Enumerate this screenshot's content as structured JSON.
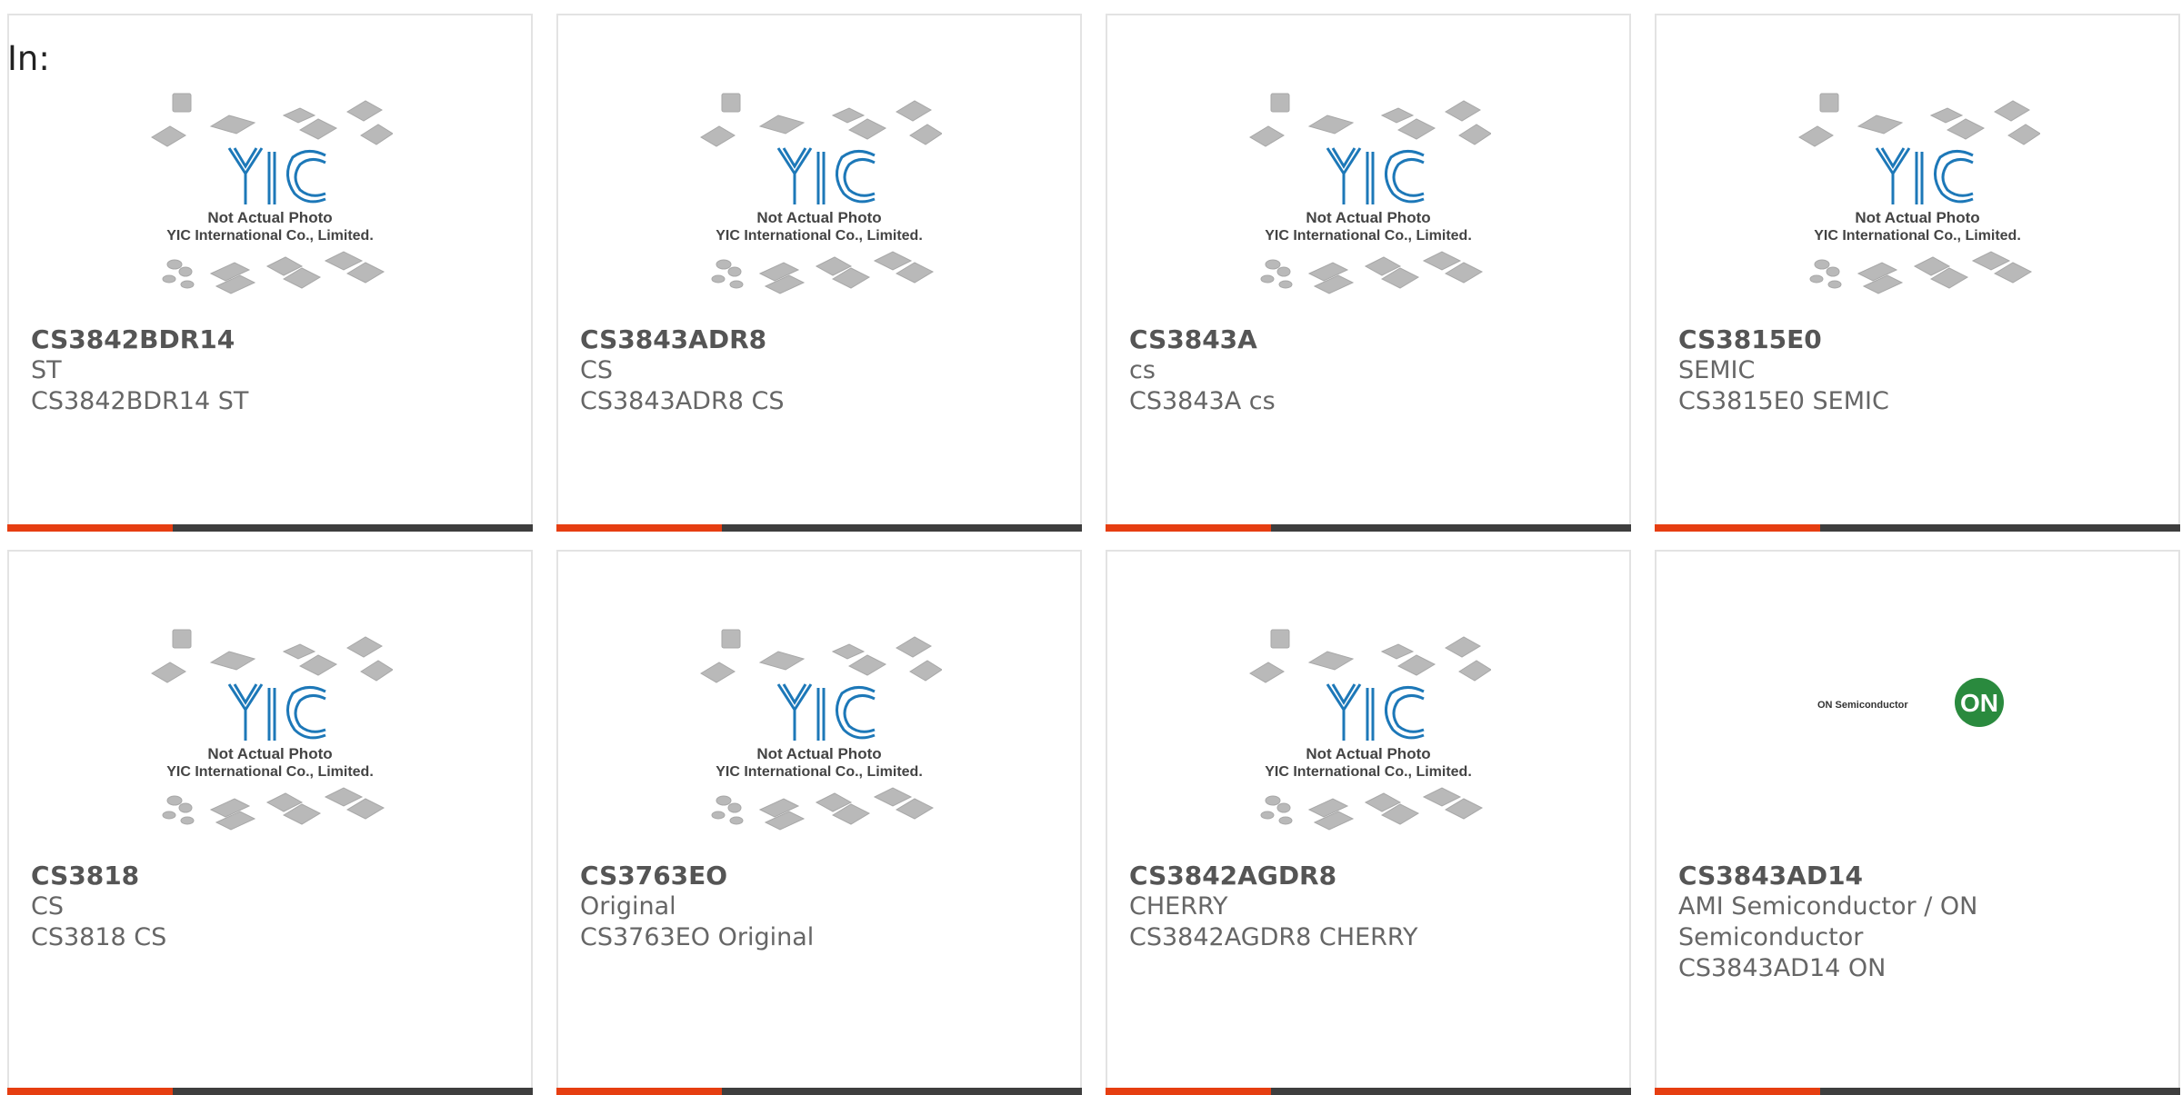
{
  "header": {
    "label": "In:"
  },
  "placeholder": {
    "line1": "Not Actual Photo",
    "line2": "YIC International Co., Limited.",
    "brand": "YIC"
  },
  "brand_logo": {
    "text": "ON Semiconductor",
    "badge": "ON",
    "badge_color": "#2a8a3e"
  },
  "colors": {
    "accent": "#e63e11",
    "bar": "#3e3e3e",
    "border": "#e3e3e3"
  },
  "products": [
    {
      "part": "CS3842BDR14",
      "mfr": "ST",
      "desc": "CS3842BDR14 ST"
    },
    {
      "part": "CS3843ADR8",
      "mfr": "CS",
      "desc": "CS3843ADR8 CS"
    },
    {
      "part": "CS3843A",
      "mfr": "cs",
      "desc": "CS3843A cs"
    },
    {
      "part": "CS3815E0",
      "mfr": "SEMIC",
      "desc": "CS3815E0 SEMIC"
    },
    {
      "part": "CS3818",
      "mfr": "CS",
      "desc": "CS3818 CS"
    },
    {
      "part": "CS3763EO",
      "mfr": "Original",
      "desc": "CS3763EO Original"
    },
    {
      "part": "CS3842AGDR8",
      "mfr": "CHERRY",
      "desc": "CS3842AGDR8 CHERRY"
    },
    {
      "part": "CS3843AD14",
      "mfr": "AMI Semiconductor / ON Semiconductor",
      "desc": "CS3843AD14 ON"
    }
  ]
}
